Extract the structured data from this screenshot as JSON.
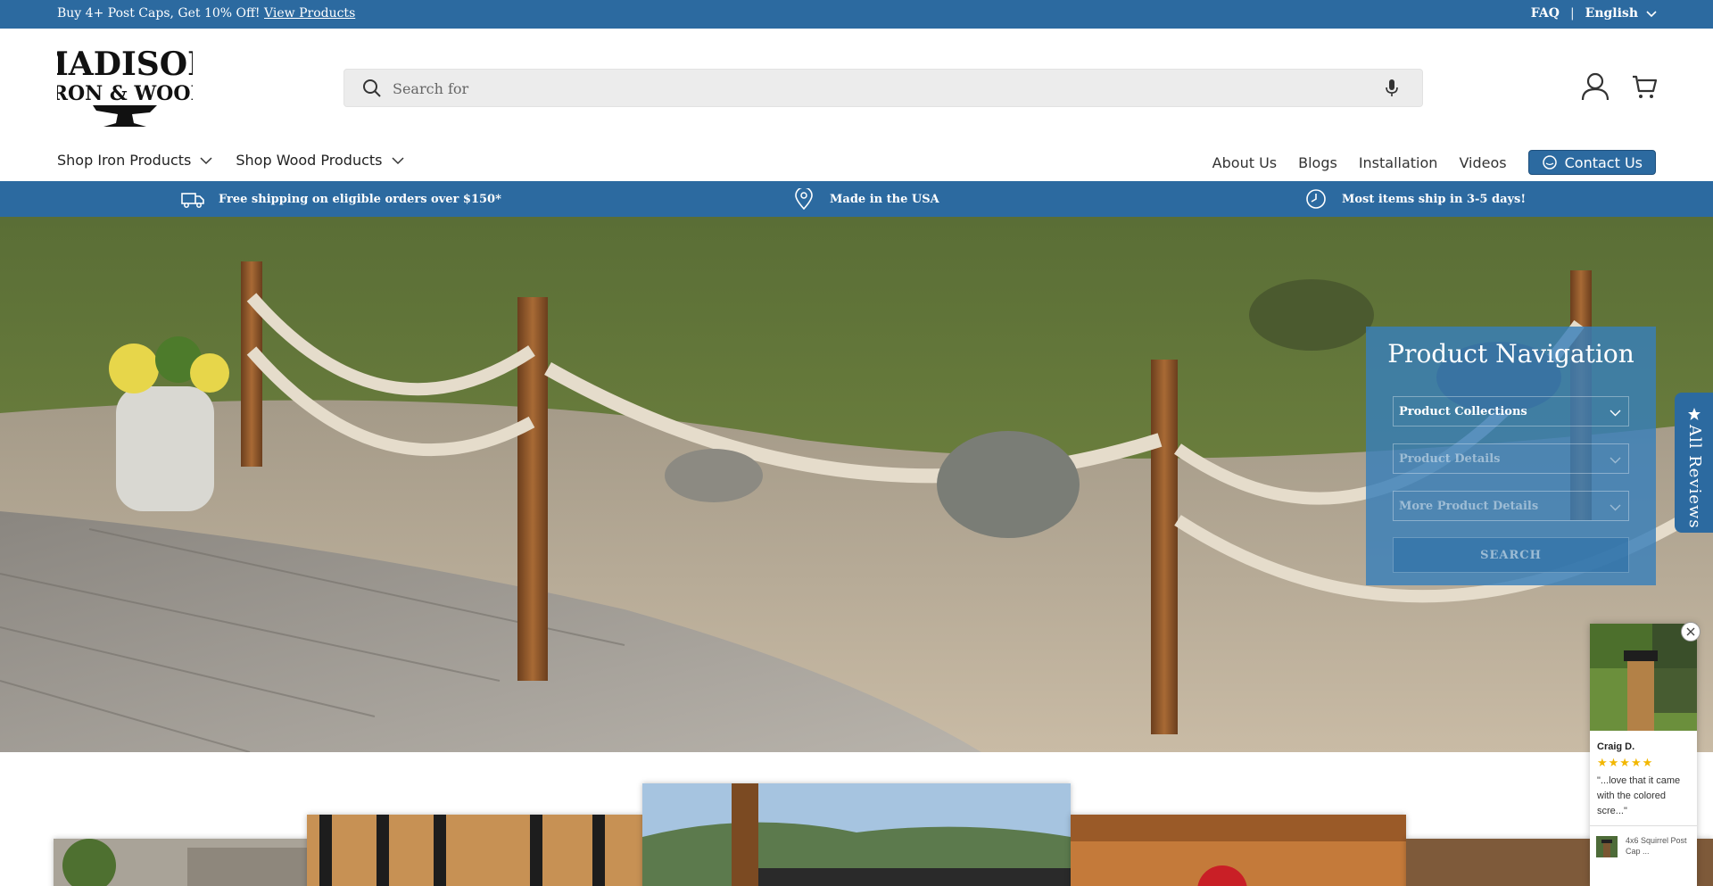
{
  "announcement": {
    "promo_text": "Buy 4+ Post Caps, Get 10% Off!",
    "promo_link": "View Products",
    "faq": "FAQ",
    "separator": "|",
    "language": "English"
  },
  "header": {
    "logo_line1": "MADISON",
    "logo_line2": "IRON & WOOD",
    "search_placeholder": "Search for"
  },
  "nav": {
    "left": [
      "Shop Iron Products",
      "Shop Wood Products"
    ],
    "right": [
      "About Us",
      "Blogs",
      "Installation",
      "Videos"
    ],
    "contact": "Contact Us"
  },
  "benefits": [
    {
      "icon": "truck-icon",
      "text": "Free shipping on eligible orders over $150*"
    },
    {
      "icon": "location-pin-icon",
      "text": "Made in the USA"
    },
    {
      "icon": "clock-icon",
      "text": "Most items ship in 3-5 days!"
    }
  ],
  "product_navigation": {
    "title": "Product Navigation",
    "selects": [
      "Product Collections",
      "Product Details",
      "More Product Details"
    ],
    "search_button": "SEARCH"
  },
  "reviews_tab": {
    "label": "All Reviews",
    "icon": "star-icon"
  },
  "review_popup": {
    "reviewer": "Craig D.",
    "rating": 5,
    "quote": "\"...love that it came with the colored scre...\"",
    "product": "4x6 Squirrel Post Cap ..."
  },
  "colors": {
    "brand_blue": "#2c6aa0",
    "star_gold": "#f2b700"
  }
}
